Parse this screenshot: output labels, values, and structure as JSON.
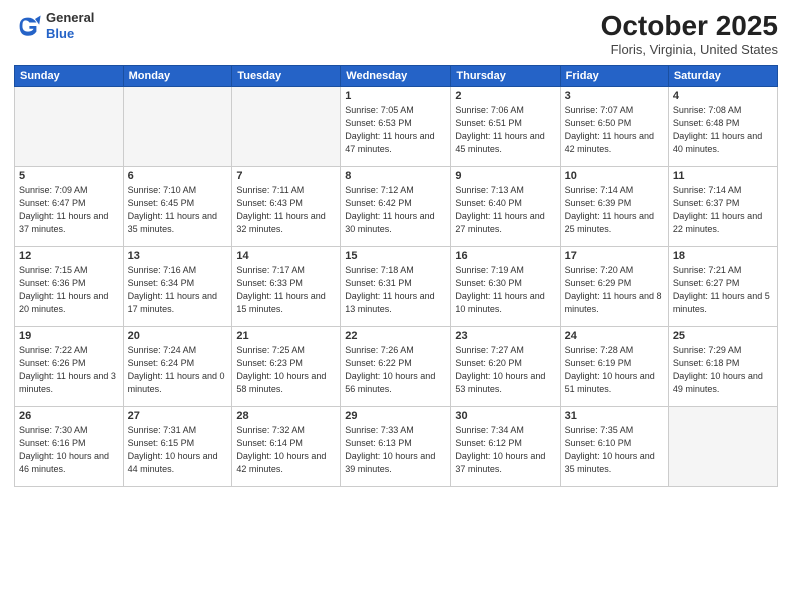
{
  "header": {
    "logo_general": "General",
    "logo_blue": "Blue",
    "month_title": "October 2025",
    "location": "Floris, Virginia, United States"
  },
  "days_of_week": [
    "Sunday",
    "Monday",
    "Tuesday",
    "Wednesday",
    "Thursday",
    "Friday",
    "Saturday"
  ],
  "weeks": [
    [
      {
        "day": "",
        "empty": true
      },
      {
        "day": "",
        "empty": true
      },
      {
        "day": "",
        "empty": true
      },
      {
        "day": "1",
        "sunrise": "7:05 AM",
        "sunset": "6:53 PM",
        "daylight": "11 hours and 47 minutes."
      },
      {
        "day": "2",
        "sunrise": "7:06 AM",
        "sunset": "6:51 PM",
        "daylight": "11 hours and 45 minutes."
      },
      {
        "day": "3",
        "sunrise": "7:07 AM",
        "sunset": "6:50 PM",
        "daylight": "11 hours and 42 minutes."
      },
      {
        "day": "4",
        "sunrise": "7:08 AM",
        "sunset": "6:48 PM",
        "daylight": "11 hours and 40 minutes."
      }
    ],
    [
      {
        "day": "5",
        "sunrise": "7:09 AM",
        "sunset": "6:47 PM",
        "daylight": "11 hours and 37 minutes."
      },
      {
        "day": "6",
        "sunrise": "7:10 AM",
        "sunset": "6:45 PM",
        "daylight": "11 hours and 35 minutes."
      },
      {
        "day": "7",
        "sunrise": "7:11 AM",
        "sunset": "6:43 PM",
        "daylight": "11 hours and 32 minutes."
      },
      {
        "day": "8",
        "sunrise": "7:12 AM",
        "sunset": "6:42 PM",
        "daylight": "11 hours and 30 minutes."
      },
      {
        "day": "9",
        "sunrise": "7:13 AM",
        "sunset": "6:40 PM",
        "daylight": "11 hours and 27 minutes."
      },
      {
        "day": "10",
        "sunrise": "7:14 AM",
        "sunset": "6:39 PM",
        "daylight": "11 hours and 25 minutes."
      },
      {
        "day": "11",
        "sunrise": "7:14 AM",
        "sunset": "6:37 PM",
        "daylight": "11 hours and 22 minutes."
      }
    ],
    [
      {
        "day": "12",
        "sunrise": "7:15 AM",
        "sunset": "6:36 PM",
        "daylight": "11 hours and 20 minutes."
      },
      {
        "day": "13",
        "sunrise": "7:16 AM",
        "sunset": "6:34 PM",
        "daylight": "11 hours and 17 minutes."
      },
      {
        "day": "14",
        "sunrise": "7:17 AM",
        "sunset": "6:33 PM",
        "daylight": "11 hours and 15 minutes."
      },
      {
        "day": "15",
        "sunrise": "7:18 AM",
        "sunset": "6:31 PM",
        "daylight": "11 hours and 13 minutes."
      },
      {
        "day": "16",
        "sunrise": "7:19 AM",
        "sunset": "6:30 PM",
        "daylight": "11 hours and 10 minutes."
      },
      {
        "day": "17",
        "sunrise": "7:20 AM",
        "sunset": "6:29 PM",
        "daylight": "11 hours and 8 minutes."
      },
      {
        "day": "18",
        "sunrise": "7:21 AM",
        "sunset": "6:27 PM",
        "daylight": "11 hours and 5 minutes."
      }
    ],
    [
      {
        "day": "19",
        "sunrise": "7:22 AM",
        "sunset": "6:26 PM",
        "daylight": "11 hours and 3 minutes."
      },
      {
        "day": "20",
        "sunrise": "7:24 AM",
        "sunset": "6:24 PM",
        "daylight": "11 hours and 0 minutes."
      },
      {
        "day": "21",
        "sunrise": "7:25 AM",
        "sunset": "6:23 PM",
        "daylight": "10 hours and 58 minutes."
      },
      {
        "day": "22",
        "sunrise": "7:26 AM",
        "sunset": "6:22 PM",
        "daylight": "10 hours and 56 minutes."
      },
      {
        "day": "23",
        "sunrise": "7:27 AM",
        "sunset": "6:20 PM",
        "daylight": "10 hours and 53 minutes."
      },
      {
        "day": "24",
        "sunrise": "7:28 AM",
        "sunset": "6:19 PM",
        "daylight": "10 hours and 51 minutes."
      },
      {
        "day": "25",
        "sunrise": "7:29 AM",
        "sunset": "6:18 PM",
        "daylight": "10 hours and 49 minutes."
      }
    ],
    [
      {
        "day": "26",
        "sunrise": "7:30 AM",
        "sunset": "6:16 PM",
        "daylight": "10 hours and 46 minutes."
      },
      {
        "day": "27",
        "sunrise": "7:31 AM",
        "sunset": "6:15 PM",
        "daylight": "10 hours and 44 minutes."
      },
      {
        "day": "28",
        "sunrise": "7:32 AM",
        "sunset": "6:14 PM",
        "daylight": "10 hours and 42 minutes."
      },
      {
        "day": "29",
        "sunrise": "7:33 AM",
        "sunset": "6:13 PM",
        "daylight": "10 hours and 39 minutes."
      },
      {
        "day": "30",
        "sunrise": "7:34 AM",
        "sunset": "6:12 PM",
        "daylight": "10 hours and 37 minutes."
      },
      {
        "day": "31",
        "sunrise": "7:35 AM",
        "sunset": "6:10 PM",
        "daylight": "10 hours and 35 minutes."
      },
      {
        "day": "",
        "empty": true
      }
    ]
  ]
}
